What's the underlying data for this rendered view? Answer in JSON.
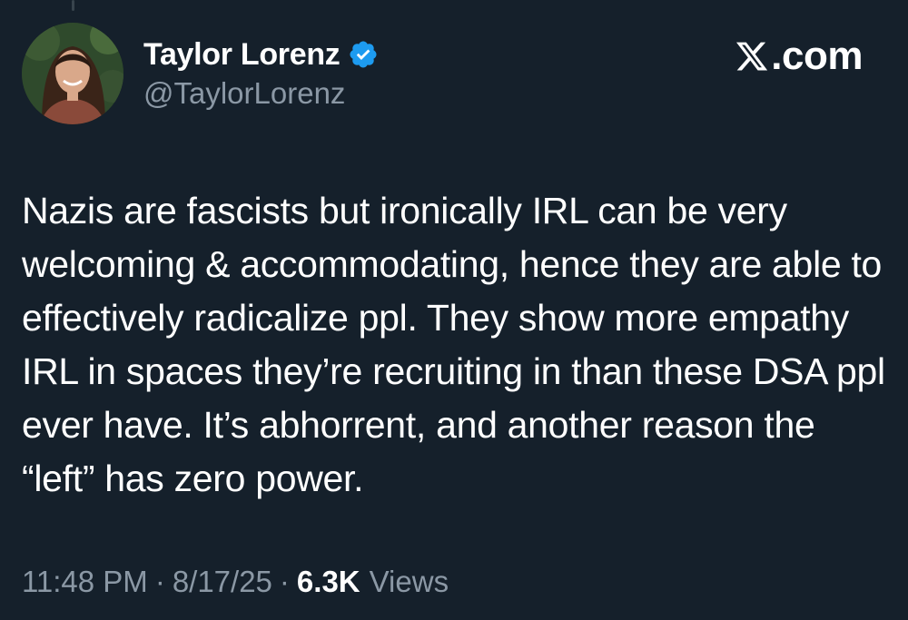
{
  "author": {
    "display_name": "Taylor Lorenz",
    "handle": "@TaylorLorenz",
    "verified": true,
    "verified_icon": "verified-badge-icon",
    "verified_color": "#1d9bf0"
  },
  "brand": {
    "label": ".com",
    "icon": "x-logo-icon"
  },
  "tweet": {
    "text": "Nazis are fascists but ironically IRL can be very welcoming & accommodating, hence they are able to effectively radicalize ppl. They show more empathy IRL in spaces they’re recruiting in than these DSA ppl ever have. It’s abhorrent, and another reason the “left” has zero power."
  },
  "meta": {
    "time": "11:48 PM",
    "separator": "·",
    "date": "8/17/25",
    "views_count": "6.3K",
    "views_label": "Views"
  },
  "colors": {
    "background": "#15202b",
    "text_primary": "#ffffff",
    "text_secondary": "#8b98a5"
  }
}
